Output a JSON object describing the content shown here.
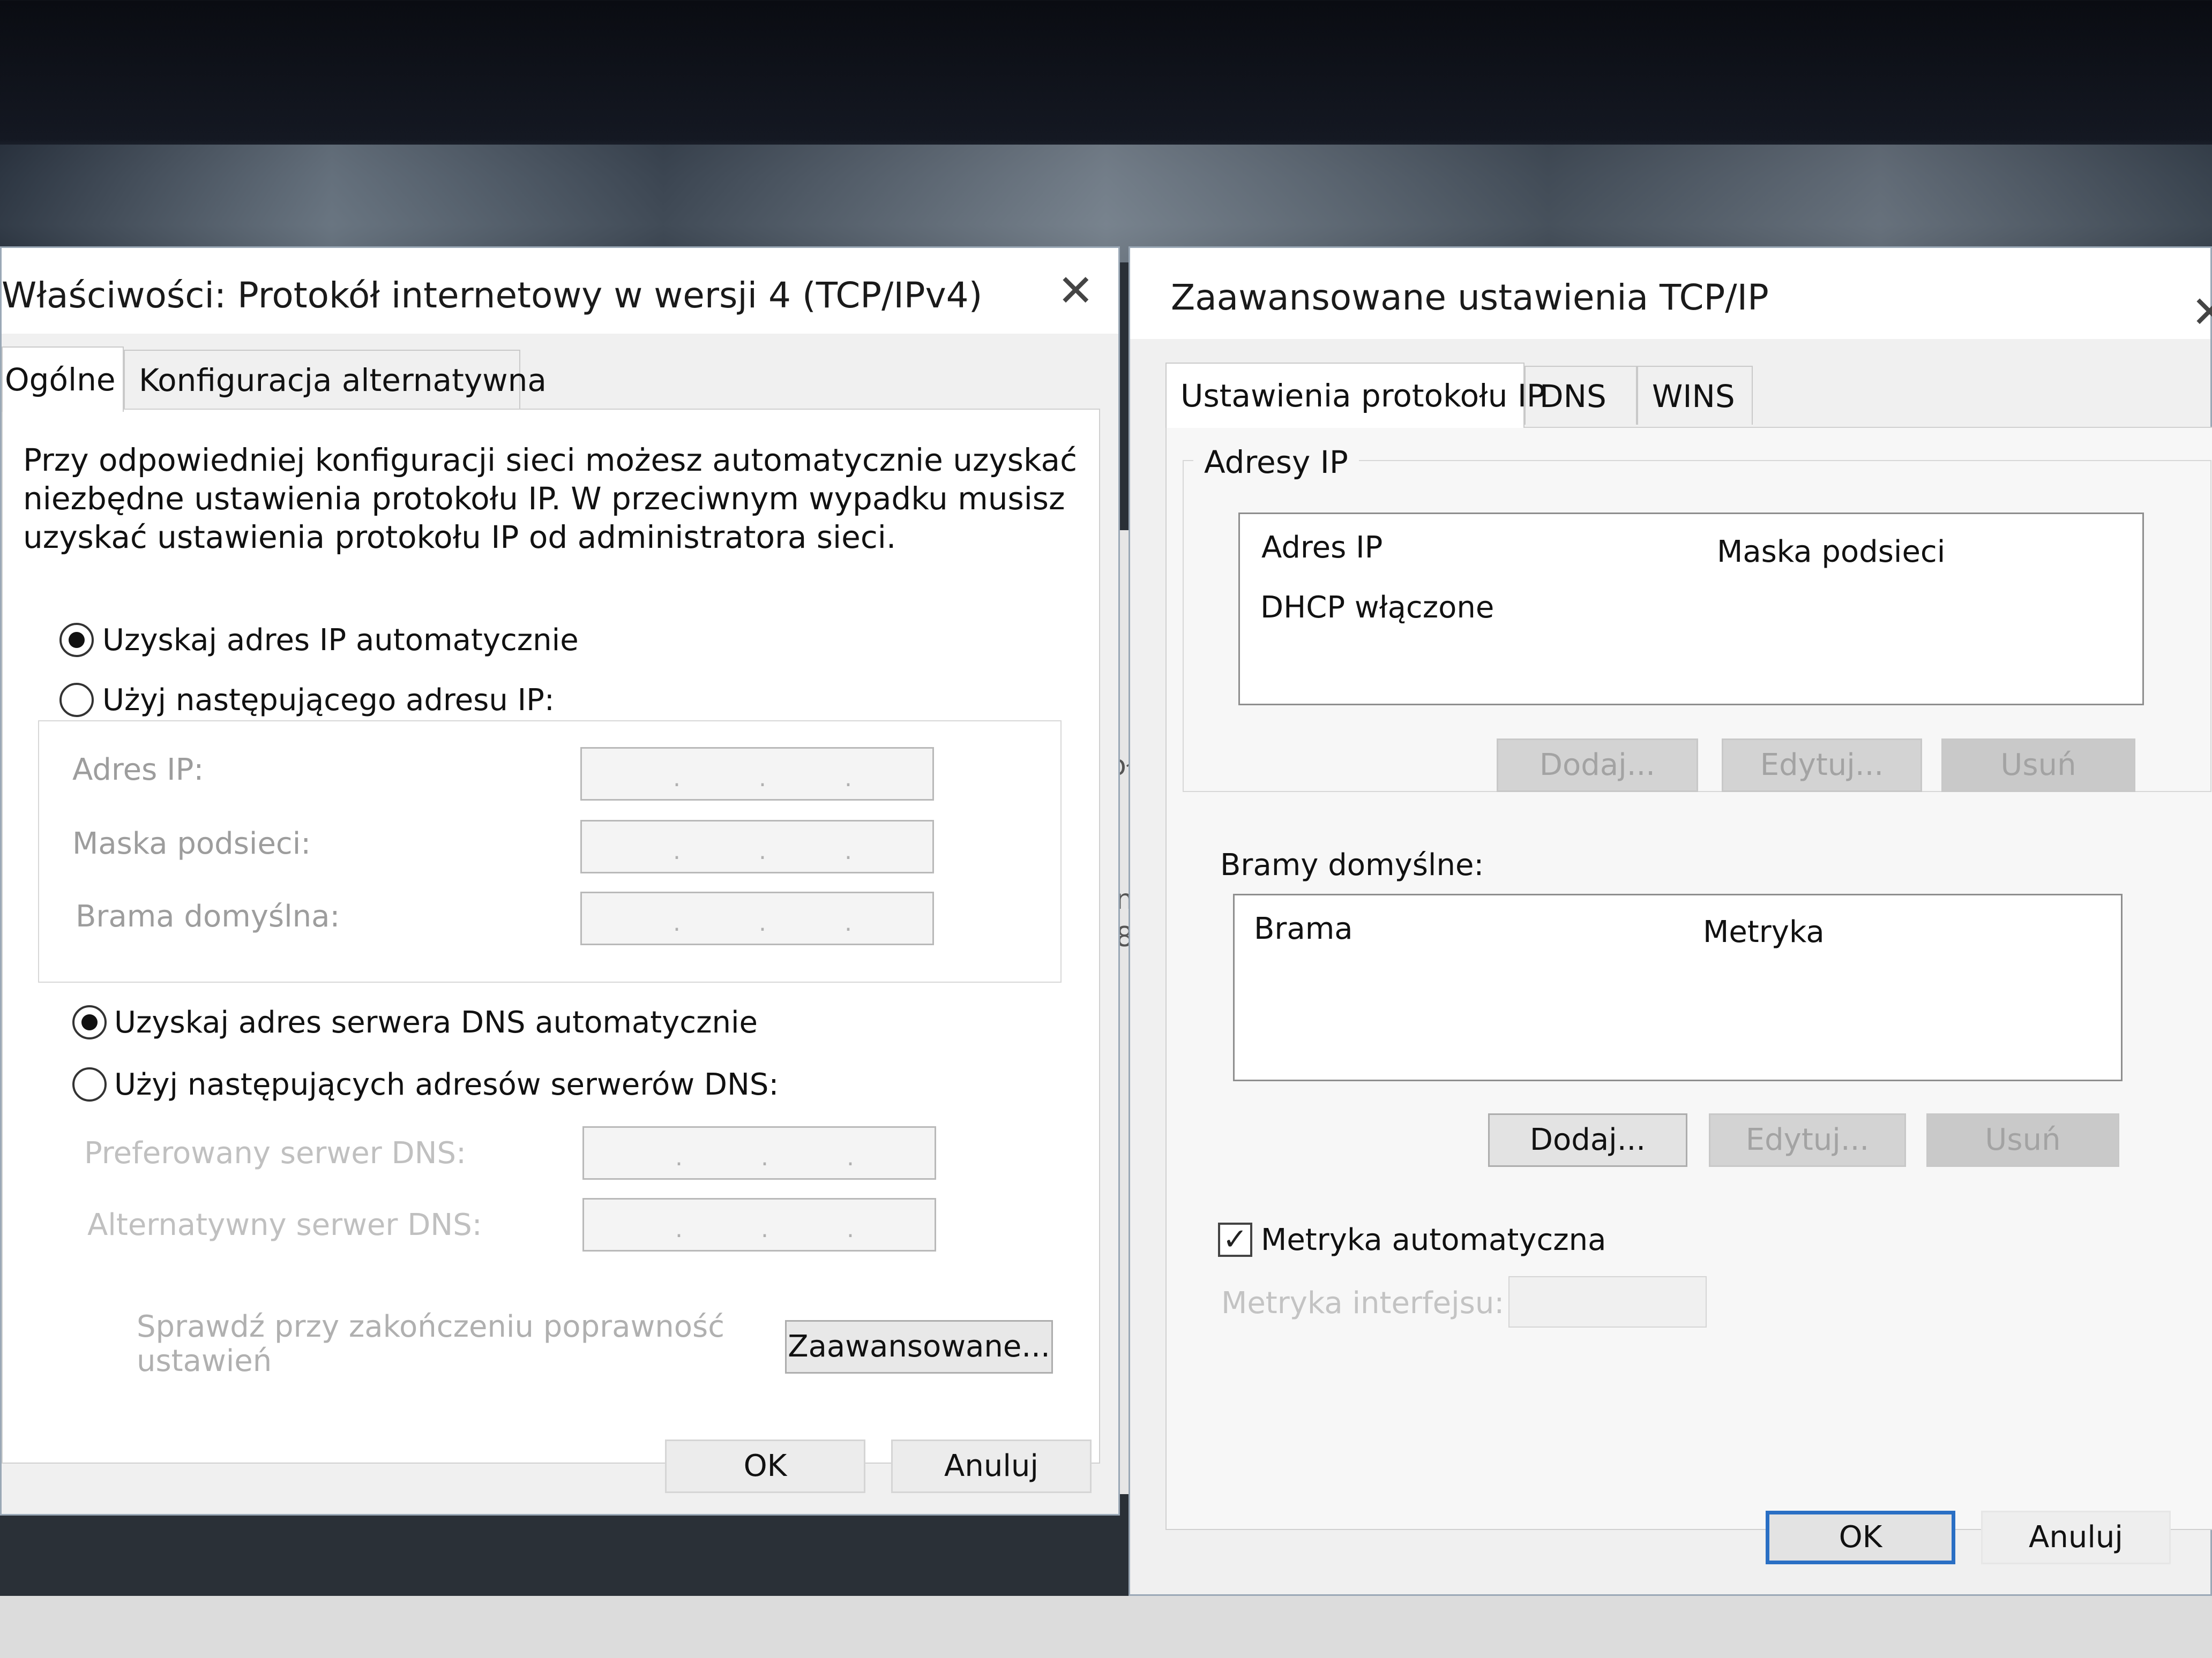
{
  "left_window": {
    "title": "Właściwości: Protokół internetowy w wersji 4 (TCP/IPv4)",
    "tabs": [
      "Ogólne",
      "Konfiguracja alternatywna"
    ],
    "description": [
      "Przy odpowiedniej konfiguracji sieci możesz automatycznie uzyskać",
      "niezbędne ustawienia protokołu IP. W przeciwnym wypadku musisz",
      "uzyskać ustawienia protokołu IP od administratora sieci."
    ],
    "ip_auto_label": "Uzyskaj adres IP automatycznie",
    "ip_manual_label": "Użyj następującego adresu IP:",
    "ip_fields": [
      "Adres IP:",
      "Maska podsieci:",
      "Brama domyślna:"
    ],
    "dns_auto_label": "Uzyskaj adres serwera DNS automatycznie",
    "dns_manual_label": "Użyj następujących adresów serwerów DNS:",
    "dns_fields": [
      "Preferowany serwer DNS:",
      "Alternatywny serwer DNS:"
    ],
    "validate_label_line1": "Sprawdź przy zakończeniu poprawność",
    "validate_label_line2": "ustawień",
    "advanced_button": "Zaawansowane...",
    "ok_button": "OK",
    "cancel_button": "Anuluj",
    "ip_dot": "."
  },
  "right_window": {
    "title": "Zaawansowane ustawienia TCP/IP",
    "tabs": [
      "Ustawienia protokołu IP",
      "DNS",
      "WINS"
    ],
    "ip_group_label": "Adresy IP",
    "ip_columns": [
      "Adres IP",
      "Maska podsieci"
    ],
    "ip_rows": [
      "DHCP włączone"
    ],
    "ip_buttons": [
      "Dodaj...",
      "Edytuj...",
      "Usuń"
    ],
    "gateway_group_label": "Bramy domyślne:",
    "gateway_columns": [
      "Brama",
      "Metryka"
    ],
    "gateway_buttons": [
      "Dodaj...",
      "Edytuj...",
      "Usuń"
    ],
    "auto_metric_label": "Metryka automatyczna",
    "interface_metric_label": "Metryka interfejsu:",
    "ok_button": "OK",
    "cancel_button": "Anuluj"
  },
  "behind_window_fragments": [
    "oł",
    "n",
    "8"
  ]
}
